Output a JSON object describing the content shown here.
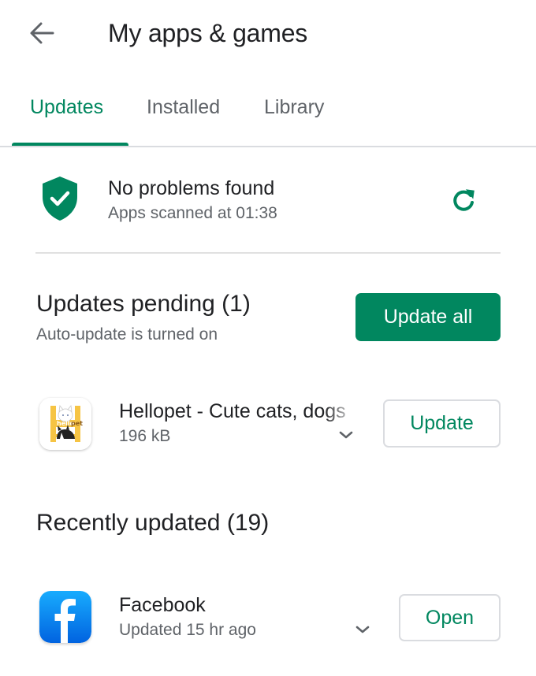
{
  "header": {
    "back_icon": "arrow-back-icon",
    "title": "My apps & games"
  },
  "tabs": [
    {
      "label": "Updates",
      "active": true
    },
    {
      "label": "Installed",
      "active": false
    },
    {
      "label": "Library",
      "active": false
    }
  ],
  "play_protect": {
    "icon": "shield-check-icon",
    "title": "No problems found",
    "subtitle": "Apps scanned at 01:38",
    "refresh_icon": "refresh-icon"
  },
  "updates_pending": {
    "title": "Updates pending (1)",
    "subtitle": "Auto-update is turned on",
    "update_all_label": "Update all",
    "apps": [
      {
        "name": "Hellopet - Cute cats, dogs",
        "detail": "196 kB",
        "icon": "hellopet-app-icon",
        "action_label": "Update"
      }
    ]
  },
  "recently_updated": {
    "title": "Recently updated (19)",
    "apps": [
      {
        "name": "Facebook",
        "detail": "Updated 15 hr ago",
        "icon": "facebook-app-icon",
        "action_label": "Open"
      }
    ]
  },
  "colors": {
    "accent": "#01875f",
    "text_primary": "#202124",
    "text_secondary": "#5f6368",
    "divider": "#dadce0",
    "facebook_blue": "#1877f2",
    "hellopet_yellow": "#f6c444"
  }
}
